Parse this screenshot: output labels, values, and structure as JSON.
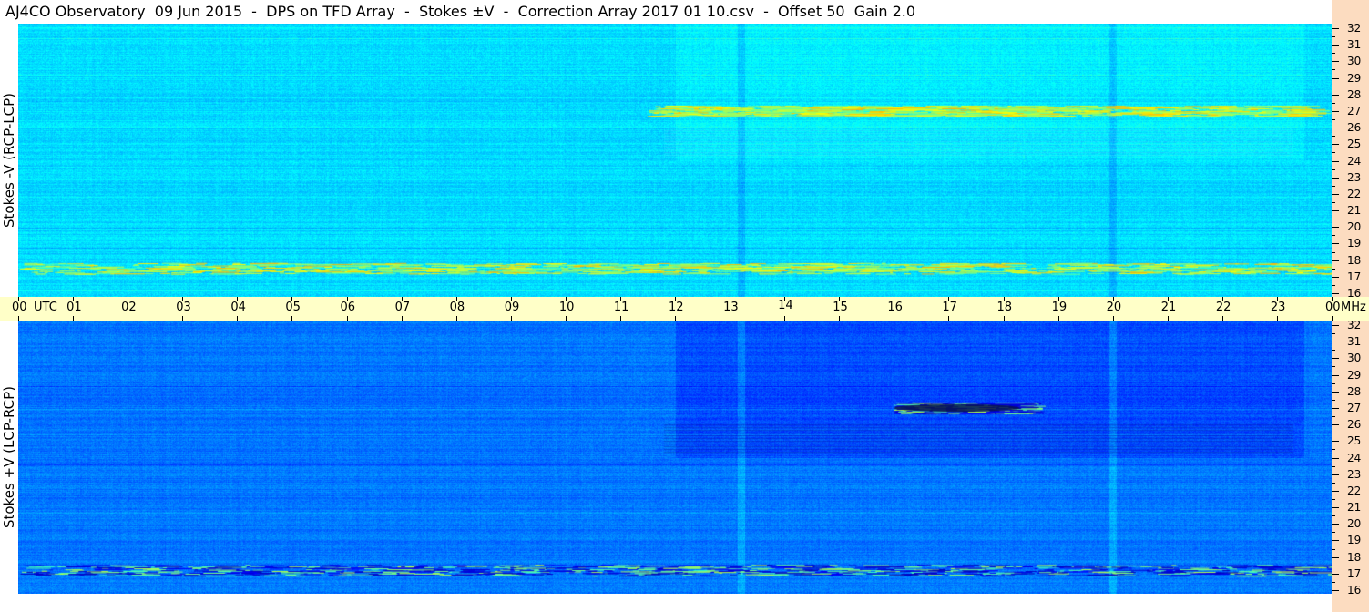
{
  "title": "AJ4CO Observatory  09 Jun 2015  -  DPS on TFD Array  -  Stokes ±V  -  Correction Array 2017 01 10.csv  -  Offset 50  Gain 2.0",
  "chart_data": [
    {
      "type": "heatmap",
      "panel": "top",
      "ylabel": "Stokes -V (RCP-LCP)",
      "x_axis": {
        "unit": "UTC",
        "ticks": [
          "00",
          "01",
          "02",
          "03",
          "04",
          "05",
          "06",
          "07",
          "08",
          "09",
          "10",
          "11",
          "12",
          "13",
          "14",
          "15",
          "16",
          "17",
          "18",
          "19",
          "20",
          "21",
          "22",
          "23",
          "00"
        ],
        "range_hours": [
          0,
          24
        ]
      },
      "y_axis": {
        "unit": "MHz",
        "range": [
          16,
          32
        ],
        "ticks": [
          16,
          17,
          18,
          19,
          20,
          21,
          22,
          23,
          24,
          25,
          26,
          27,
          28,
          29,
          30,
          31,
          32
        ]
      },
      "colormap": "jet",
      "background_color": "#1e88f0",
      "features": [
        {
          "desc": "bright emission band",
          "freq_mhz": 27,
          "utc_start": 11.5,
          "utc_end": 23.5
        },
        {
          "desc": "bright emission band",
          "freq_mhz": 17.5,
          "utc_start": 0,
          "utc_end": 24
        },
        {
          "desc": "vertical interference column",
          "utc": 13.2
        },
        {
          "desc": "vertical interference column",
          "utc": 20.0
        }
      ]
    },
    {
      "type": "heatmap",
      "panel": "bottom",
      "ylabel": "Stokes +V (LCP-RCP)",
      "x_axis": {
        "unit": "UTC",
        "ticks": [
          "00",
          "01",
          "02",
          "03",
          "04",
          "05",
          "06",
          "07",
          "08",
          "09",
          "10",
          "11",
          "12",
          "13",
          "14",
          "15",
          "16",
          "17",
          "18",
          "19",
          "20",
          "21",
          "22",
          "23",
          "00"
        ],
        "range_hours": [
          0,
          24
        ]
      },
      "y_axis": {
        "unit": "MHz",
        "range": [
          16,
          32
        ],
        "ticks": [
          16,
          17,
          18,
          19,
          20,
          21,
          22,
          23,
          24,
          25,
          26,
          27,
          28,
          29,
          30,
          31,
          32
        ]
      },
      "colormap": "jet",
      "background_color": "#1a5ae0",
      "features": [
        {
          "desc": "dark absorption band",
          "freq_mhz": 27,
          "utc_start": 16.0,
          "utc_end": 18.3
        },
        {
          "desc": "dark/bright banded region",
          "freq_mhz": 17.2,
          "utc_start": 0,
          "utc_end": 24
        },
        {
          "desc": "vertical interference column",
          "utc": 13.2
        },
        {
          "desc": "vertical interference column",
          "utc": 20.0
        }
      ]
    }
  ],
  "time_axis": {
    "start_label": "00",
    "utc_label": "UTC",
    "labels": [
      "01",
      "02",
      "03",
      "04",
      "05",
      "06",
      "07",
      "08",
      "09",
      "10",
      "11",
      "12",
      "13",
      "14",
      "15",
      "16",
      "17",
      "18",
      "19",
      "20",
      "21",
      "22",
      "23"
    ],
    "end_label": "00",
    "unit_label": "MHz"
  },
  "freq_axis": {
    "labels": [
      "32",
      "31",
      "30",
      "29",
      "28",
      "27",
      "26",
      "25",
      "24",
      "23",
      "22",
      "21",
      "20",
      "19",
      "18",
      "17",
      "16"
    ]
  }
}
